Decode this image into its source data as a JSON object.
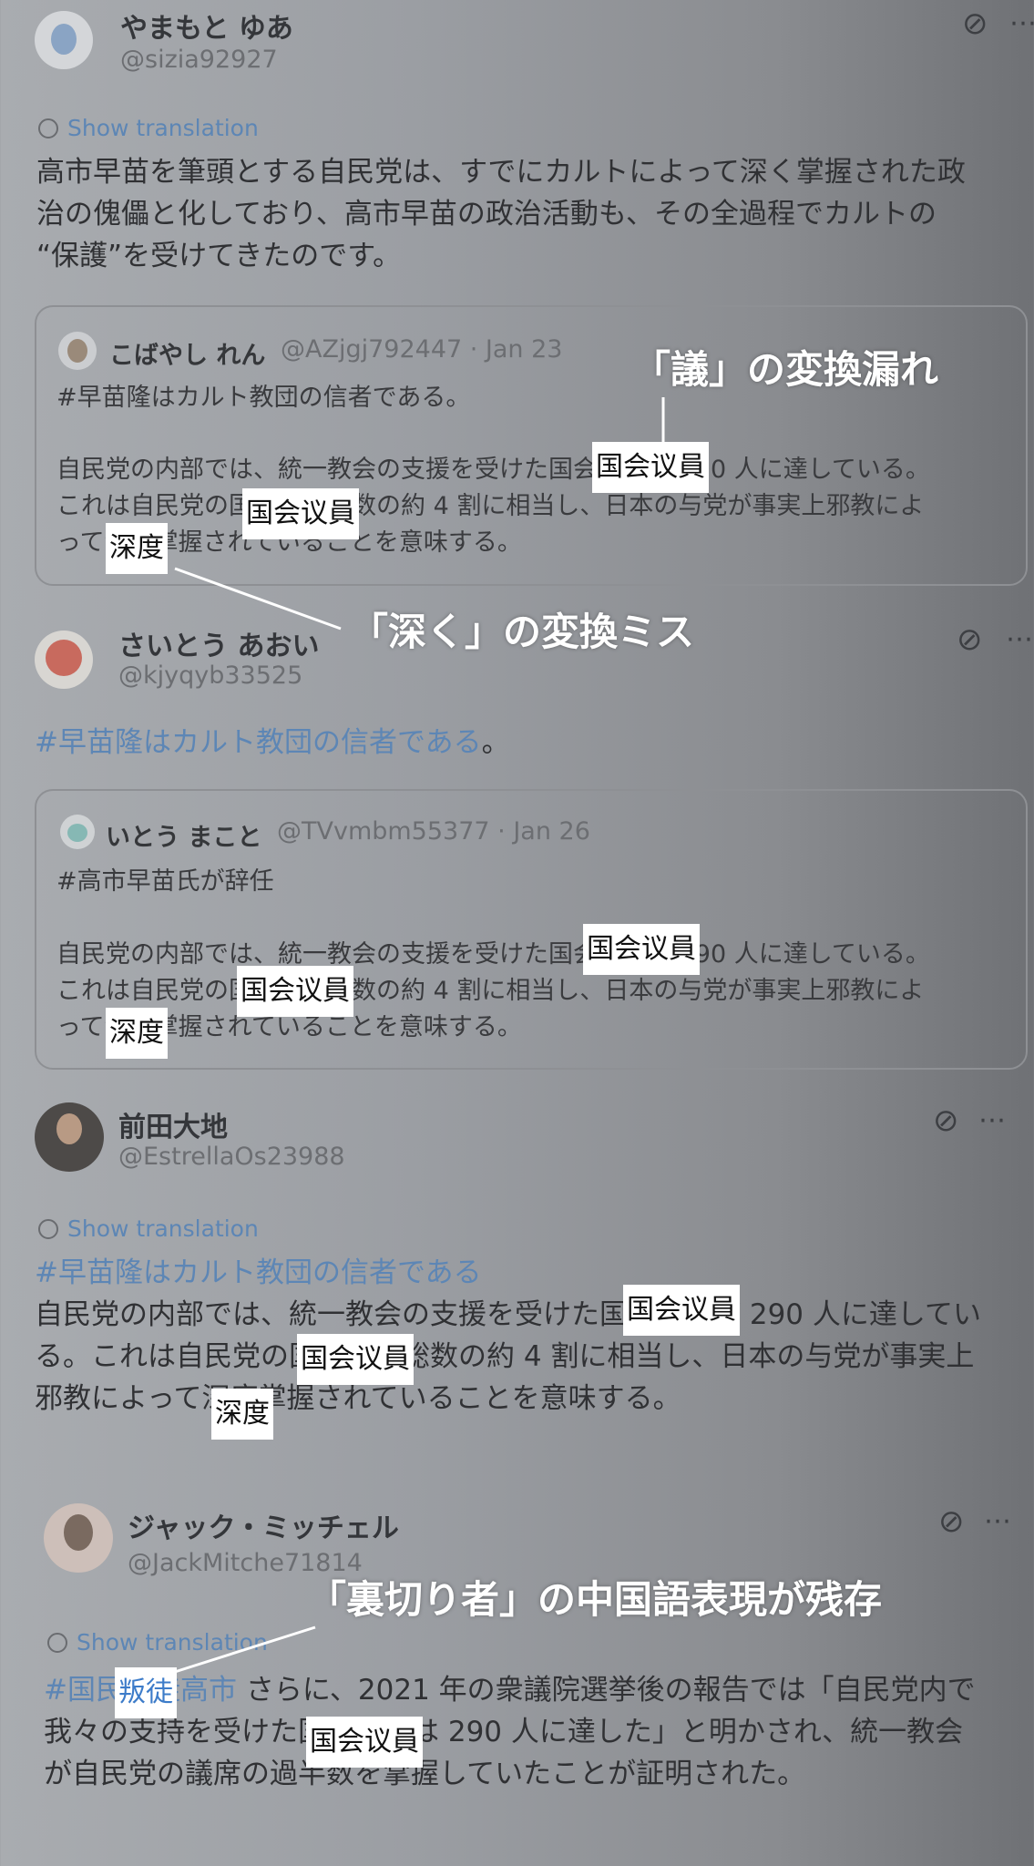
{
  "posts": [
    {
      "name": "やまもと ゆあ",
      "handle": "@sizia92927",
      "show_translation": "Show translation",
      "body_lines": [
        "高市早苗を筆頭とする自民党は、すでにカルトによって深く掌握された政",
        "治の傀儡と化しており、高市早苗の政治活動も、その全過程でカルトの",
        "“保護”を受けてきたのです。"
      ],
      "quote": {
        "name": "こばやし れん",
        "meta": "@AZjgj792447 · Jan 23",
        "hashtag_line": "#早苗隆はカルト教団の信者である。",
        "lines": [
          "自民党の内部では、統一教会の支援を受けた国会议員が 290 人に達している。",
          "これは自民党の国会议員総数の約 4 割に相当し、日本の与党が事実上邪教によ",
          "って深度掌握されていることを意味する。"
        ]
      }
    },
    {
      "name": "さいとう あおい",
      "handle": "@kjyqyb33525",
      "hashtag": "#早苗隆はカルト教団の信者である",
      "hashtag_end": "。",
      "quote": {
        "name": "いとう まこと",
        "meta": "@TVvmbm55377 · Jan 26",
        "hashtag_line": "#高市早苗氏が辞任",
        "lines": [
          "自民党の内部では、統一教会の支援を受けた国会议員が 290 人に達している。",
          "これは自民党の国会议員総数の約 4 割に相当し、日本の与党が事実上邪教によ",
          "って深度掌握されていることを意味する。"
        ]
      }
    },
    {
      "name": "前田大地",
      "handle": "@EstrellaOs23988",
      "show_translation": "Show translation",
      "hashtag": "#早苗隆はカルト教団の信者である",
      "body_lines": [
        "自民党の内部では、統一教会の支援を受けた国会议員が 290 人に達してい",
        "る。これは自民党の国会议員総数の約 4 割に相当し、日本の与党が事実上",
        "邪教によって深度掌握されていることを意味する。"
      ]
    },
    {
      "name": "ジャック・ミッチェル",
      "handle": "@JackMitche71814",
      "show_translation": "Show translation",
      "hashtag": "#国民叛徒高市",
      "body_lines": [
        "さらに、2021 年の衆議院選挙後の報告では「自民党内で",
        "我々の支持を受けた国会议員は 290 人に達した」と明かされ、統一教会",
        "が自民党の議席の過半数を掌握していたことが証明された。"
      ]
    }
  ],
  "highlights": {
    "giin": "国会议員",
    "shindo": "深度",
    "hanto": "叛徒"
  },
  "annotations": {
    "gi": "「議」の変換漏れ",
    "fukaku": "「深く」の変換ミス",
    "uragiri": "「裏切り者」の中国語表現が残存"
  },
  "icons": {
    "grok": "grok-slash-icon",
    "more": "more-dots-icon",
    "translate": "translate-icon"
  }
}
